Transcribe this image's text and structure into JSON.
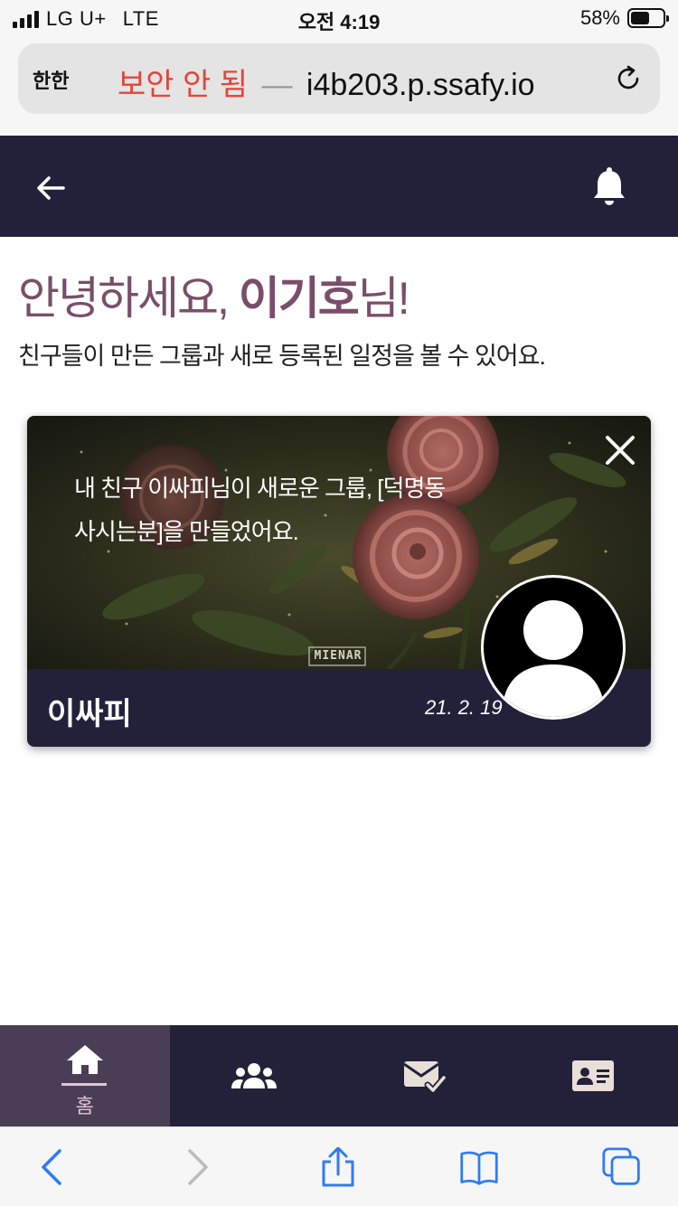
{
  "status_bar": {
    "carrier": "LG U+",
    "network": "LTE",
    "time": "오전 4:19",
    "battery_percent_text": "58%",
    "battery_level": 0.58
  },
  "address_bar": {
    "reader_label": "한한",
    "insecure_label": "보안 안 됨",
    "separator": "—",
    "host": "i4b203.p.ssafy.io",
    "reload_icon": "reload-icon"
  },
  "app_header": {
    "back_icon": "arrow-left-icon",
    "bell_icon": "bell-icon"
  },
  "greeting": {
    "prefix": "안녕하세요, ",
    "user_name": "이기호",
    "suffix": "님!",
    "subtitle": "친구들이 만든 그룹과 새로 등록된 일정을 볼 수 있어요."
  },
  "notification_card": {
    "message_line1": "내 친구 이싸피님이 새로운 그룹, [덕명동",
    "message_line2": "사시는분]을 만들었어요.",
    "friend_name": "이싸피",
    "date": "21. 2. 19",
    "watermark": "MIENAR",
    "close_icon": "close-icon",
    "avatar_icon": "user-avatar-icon"
  },
  "tab_bar": {
    "tabs": [
      {
        "icon": "home-icon",
        "label": "홈",
        "active": true
      },
      {
        "icon": "group-icon",
        "label": "",
        "active": false
      },
      {
        "icon": "mail-check-icon",
        "label": "",
        "active": false
      },
      {
        "icon": "id-card-icon",
        "label": "",
        "active": false
      }
    ]
  },
  "colors": {
    "header_bg": "#23213a",
    "accent": "#7a4e6b",
    "active_tab_bg": "#4a3e57",
    "safari_blue": "#2f7bf5",
    "insecure_red": "#e0463b"
  }
}
